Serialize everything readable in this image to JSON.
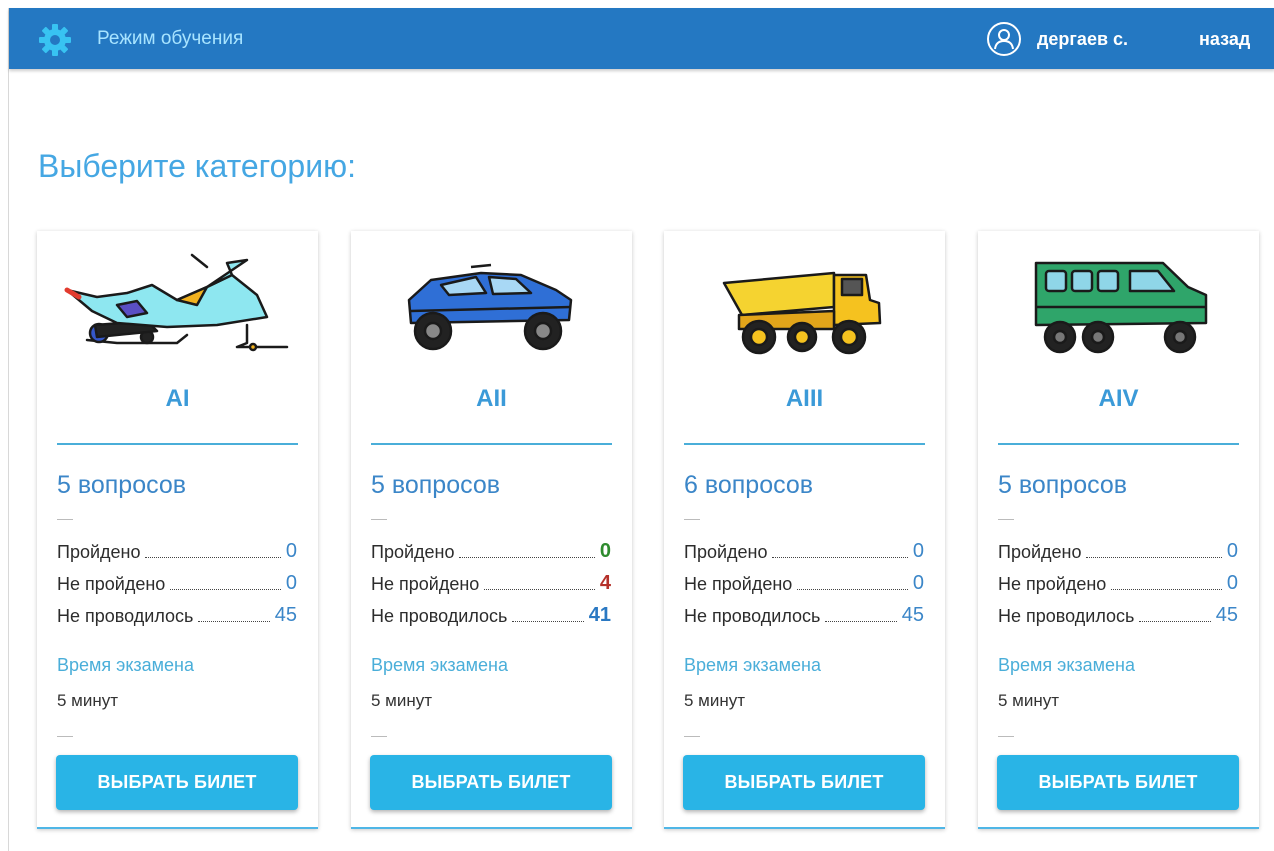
{
  "header": {
    "mode_title": "Режим обучения",
    "user_name": "дергаев с.",
    "back_label": "назад",
    "bg_color": "#2478c2"
  },
  "page_title": "Выберите категорию:",
  "stat_labels": {
    "passed": "Пройдено",
    "failed": "Не пройдено",
    "not_done": "Не проводилось"
  },
  "cards": [
    {
      "category": "AI",
      "vehicle_icon": "snowmobile-icon",
      "questions": "5 вопросов",
      "passed": "0",
      "failed": "0",
      "not_done": "45",
      "time_label": "Время экзамена",
      "time_value": "5 минут",
      "button_label": "ВЫБРАТЬ БИЛЕТ"
    },
    {
      "category": "AII",
      "vehicle_icon": "offroad-car-icon",
      "questions": "5 вопросов",
      "passed": "0",
      "failed": "4",
      "not_done": "41",
      "time_label": "Время экзамена",
      "time_value": "5 минут",
      "button_label": "ВЫБРАТЬ БИЛЕТ"
    },
    {
      "category": "AIII",
      "vehicle_icon": "dump-truck-icon",
      "questions": "6 вопросов",
      "passed": "0",
      "failed": "0",
      "not_done": "45",
      "time_label": "Время экзамена",
      "time_value": "5 минут",
      "button_label": "ВЫБРАТЬ БИЛЕТ"
    },
    {
      "category": "AIV",
      "vehicle_icon": "allterrain-van-icon",
      "questions": "5 вопросов",
      "passed": "0",
      "failed": "0",
      "not_done": "45",
      "time_label": "Время экзамена",
      "time_value": "5 минут",
      "button_label": "ВЫБРАТЬ БИЛЕТ"
    }
  ]
}
